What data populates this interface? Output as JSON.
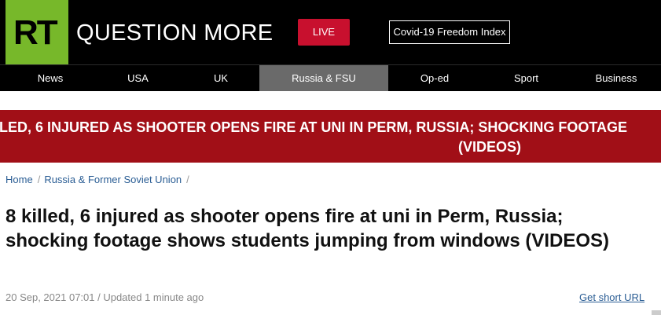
{
  "header": {
    "logo_text": "RT",
    "tagline": "QUESTION MORE",
    "live_label": "LIVE",
    "covid_label": "Covid-19 Freedom Index",
    "logo_color": "#77b82a",
    "live_color": "#c8102e"
  },
  "nav": {
    "items": [
      {
        "label": "News"
      },
      {
        "label": "USA"
      },
      {
        "label": "UK"
      },
      {
        "label": "Russia & FSU"
      },
      {
        "label": "Op-ed"
      },
      {
        "label": "Sport"
      },
      {
        "label": "Business"
      }
    ],
    "active": "Russia & FSU"
  },
  "breaking": {
    "line1": "LLED, 6 INJURED AS SHOOTER OPENS FIRE AT UNI IN PERM, RUSSIA; SHOCKING FOOTAGE",
    "line2": "(VIDEOS)",
    "color": "#a10f17"
  },
  "breadcrumb": {
    "items": [
      {
        "label": "Home"
      },
      {
        "label": "Russia & Former Soviet Union"
      }
    ],
    "separator": "/"
  },
  "article": {
    "headline": "8 killed, 6 injured as shooter opens fire at uni in Perm, Russia; shocking footage shows students jumping from windows (VIDEOS)",
    "meta": "20 Sep, 2021 07:01 / Updated 1 minute ago",
    "short_url_label": "Get short URL"
  }
}
